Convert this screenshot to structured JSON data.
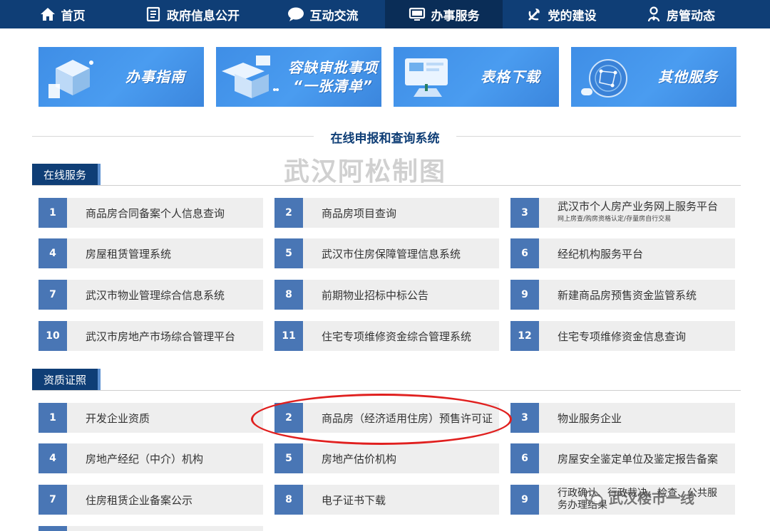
{
  "nav": {
    "items": [
      {
        "label": "首页",
        "icon": "home-icon",
        "active": false
      },
      {
        "label": "政府信息公开",
        "icon": "document-icon",
        "active": false
      },
      {
        "label": "互动交流",
        "icon": "chat-bubble-icon",
        "active": false
      },
      {
        "label": "办事服务",
        "icon": "monitor-icon",
        "active": true
      },
      {
        "label": "党的建设",
        "icon": "party-emblem-icon",
        "active": false
      },
      {
        "label": "房管动态",
        "icon": "person-icon",
        "active": false
      }
    ]
  },
  "banners": [
    {
      "line1": "办事指南",
      "line2": ""
    },
    {
      "line1": "容缺审批事项",
      "line2": "“一张清单”"
    },
    {
      "line1": "表格下载",
      "line2": ""
    },
    {
      "line1": "其他服务",
      "line2": ""
    }
  ],
  "system_title": "在线申报和查询系统",
  "watermark": "武汉阿松制图",
  "online_services": {
    "tab": "在线服务",
    "items": [
      {
        "num": "1",
        "label": "商品房合同备案个人信息查询"
      },
      {
        "num": "2",
        "label": "商品房项目查询"
      },
      {
        "num": "3",
        "label": "武汉市个人房产业务网上服务平台",
        "sub": "网上房查/购房资格认定/存量房自行交易"
      },
      {
        "num": "4",
        "label": "房屋租赁管理系统"
      },
      {
        "num": "5",
        "label": "武汉市住房保障管理信息系统"
      },
      {
        "num": "6",
        "label": "经纪机构服务平台"
      },
      {
        "num": "7",
        "label": "武汉市物业管理综合信息系统"
      },
      {
        "num": "8",
        "label": "前期物业招标中标公告"
      },
      {
        "num": "9",
        "label": "新建商品房预售资金监管系统"
      },
      {
        "num": "10",
        "label": "武汉市房地产市场综合管理平台"
      },
      {
        "num": "11",
        "label": "住宅专项维修资金综合管理系统"
      },
      {
        "num": "12",
        "label": "住宅专项维修资金信息查询"
      }
    ]
  },
  "qualification": {
    "tab": "资质证照",
    "items": [
      {
        "num": "1",
        "label": "开发企业资质"
      },
      {
        "num": "2",
        "label": "商品房（经济适用住房）预售许可证"
      },
      {
        "num": "3",
        "label": "物业服务企业"
      },
      {
        "num": "4",
        "label": "房地产经纪（中介）机构"
      },
      {
        "num": "5",
        "label": "房地产估价机构"
      },
      {
        "num": "6",
        "label": "房屋安全鉴定单位及鉴定报告备案"
      },
      {
        "num": "7",
        "label": "住房租赁企业备案公示"
      },
      {
        "num": "8",
        "label": "电子证书下载"
      },
      {
        "num": "9",
        "label": "行政确认、行政裁决、检查、公共服务办理结果"
      }
    ]
  },
  "wechat_watermark": "武汉楼市一线",
  "colors": {
    "nav_bg": "#0f3e76",
    "num_bg": "#4976b5",
    "highlight": "#e0201f"
  }
}
